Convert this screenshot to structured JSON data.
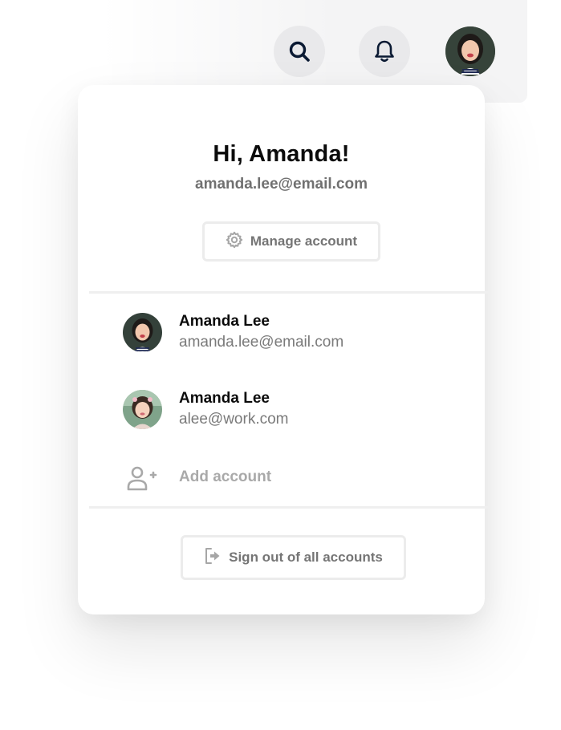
{
  "topbar": {
    "search_icon": "search-icon",
    "notifications_icon": "bell-icon",
    "avatar_icon": "avatar"
  },
  "menu": {
    "greeting": "Hi, Amanda!",
    "email": "amanda.lee@email.com",
    "manage_button": {
      "icon": "gear-icon",
      "label": "Manage account"
    },
    "accounts": [
      {
        "name": "Amanda Lee",
        "email": "amanda.lee@email.com",
        "avatar": "avatar-photo-1"
      },
      {
        "name": "Amanda Lee",
        "email": "alee@work.com",
        "avatar": "avatar-photo-2"
      }
    ],
    "add_account": {
      "icon": "add-user-icon",
      "label": "Add account"
    },
    "sign_out": {
      "icon": "sign-out-icon",
      "label": "Sign out of all accounts"
    }
  },
  "colors": {
    "primary_text": "#0b0b0b",
    "secondary_text": "#707070",
    "muted_text": "#a9a9a9",
    "icon_dark": "#0b1a33",
    "border": "#ececec"
  }
}
